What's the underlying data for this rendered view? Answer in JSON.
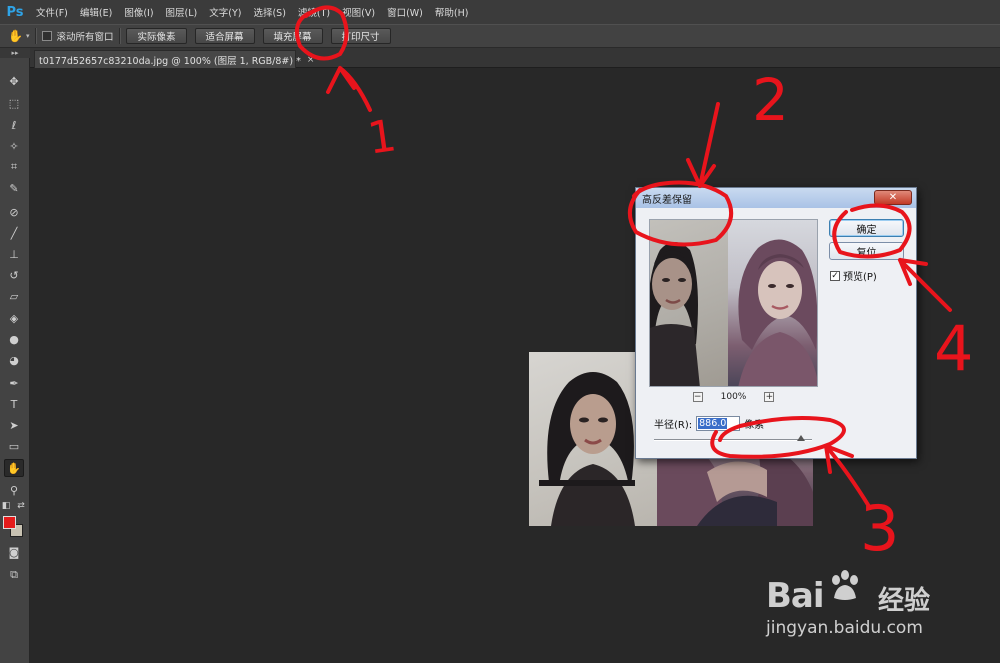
{
  "app": {
    "logo": "Ps"
  },
  "menu": [
    "文件(F)",
    "编辑(E)",
    "图像(I)",
    "图层(L)",
    "文字(Y)",
    "选择(S)",
    "滤镜(T)",
    "视图(V)",
    "窗口(W)",
    "帮助(H)"
  ],
  "options": {
    "scroll_all_label": "滚动所有窗口",
    "buttons": [
      "实际像素",
      "适合屏幕",
      "填充屏幕",
      "打印尺寸"
    ]
  },
  "document_tab": {
    "title": "t0177d52657c83210da.jpg @ 100% (图层 1, RGB/8#) *",
    "close": "×"
  },
  "tools": [
    "move-icon",
    "marquee-icon",
    "lasso-icon",
    "magic-wand-icon",
    "crop-icon",
    "eyedropper-icon",
    "healing-brush-icon",
    "brush-icon",
    "clone-stamp-icon",
    "history-brush-icon",
    "eraser-icon",
    "paint-bucket-icon",
    "blur-icon",
    "dodge-icon",
    "pen-icon",
    "type-icon",
    "path-selection-icon",
    "rectangle-icon",
    "hand-icon",
    "zoom-icon"
  ],
  "colors": {
    "foreground": "#e41b1b",
    "background": "#c8c2b2",
    "annotation": "#e8141c"
  },
  "dialog": {
    "title": "高反差保留",
    "close": "✕",
    "ok_label": "确定",
    "reset_label": "复位",
    "preview_label": "预览(P)",
    "preview_checked": "✓",
    "zoom_minus": "−",
    "zoom_plus": "+",
    "zoom_level": "100%",
    "radius_label": "半径(R):",
    "radius_value": "886.0",
    "radius_unit": "像素",
    "slider_fraction": 0.93
  },
  "annotations": [
    "1",
    "2",
    "3",
    "4"
  ],
  "watermark": {
    "logo": "Bai",
    "cn": "经验",
    "url": "jingyan.baidu.com"
  }
}
